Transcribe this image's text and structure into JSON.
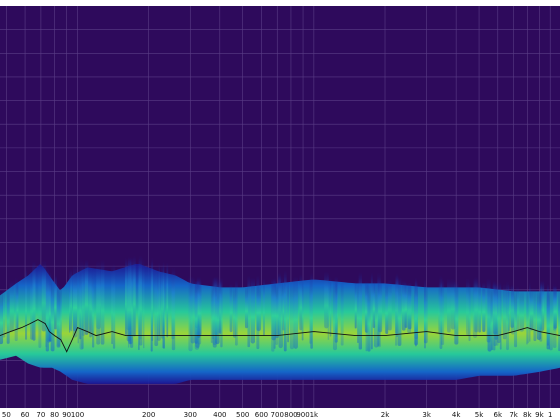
{
  "chart_data": {
    "type": "heatmap",
    "subtype": "waterfall-spectrogram",
    "title": "",
    "xlabel": "",
    "ylabel": "",
    "x_scale": "log",
    "xlim": [
      47,
      11000
    ],
    "grid": true,
    "legend": "none",
    "x_ticks": [
      {
        "value": 50,
        "label": "50"
      },
      {
        "value": 60,
        "label": "60"
      },
      {
        "value": 70,
        "label": "70"
      },
      {
        "value": 80,
        "label": "80"
      },
      {
        "value": 90,
        "label": "90"
      },
      {
        "value": 100,
        "label": "100"
      },
      {
        "value": 200,
        "label": "200"
      },
      {
        "value": 300,
        "label": "300"
      },
      {
        "value": 400,
        "label": "400"
      },
      {
        "value": 500,
        "label": "500"
      },
      {
        "value": 600,
        "label": "600"
      },
      {
        "value": 700,
        "label": "700"
      },
      {
        "value": 800,
        "label": "800"
      },
      {
        "value": 900,
        "label": "900"
      },
      {
        "value": 1000,
        "label": "1k"
      },
      {
        "value": 2000,
        "label": "2k"
      },
      {
        "value": 3000,
        "label": "3k"
      },
      {
        "value": 4000,
        "label": "4k"
      },
      {
        "value": 5000,
        "label": "5k"
      },
      {
        "value": 6000,
        "label": "6k"
      },
      {
        "value": 7000,
        "label": "7k"
      },
      {
        "value": 8000,
        "label": "8k"
      },
      {
        "value": 9000,
        "label": "9k"
      },
      {
        "value": 10000,
        "label": "1"
      }
    ],
    "colors": {
      "background": "#2e0a5c",
      "grid": "#5a3d86",
      "low": "#1a1a9a",
      "mid": "#1565c8",
      "high": "#27c99a",
      "peak": "#9ad43a",
      "trace": "#111111"
    },
    "y_range": [
      0,
      1
    ],
    "energy_profile": {
      "x": [
        47,
        55,
        62,
        70,
        78,
        85,
        95,
        110,
        140,
        180,
        220,
        260,
        300,
        400,
        500,
        700,
        1000,
        1500,
        2000,
        3000,
        4000,
        5000,
        7000,
        9000,
        11000
      ],
      "top": [
        0.28,
        0.31,
        0.33,
        0.36,
        0.32,
        0.29,
        0.33,
        0.35,
        0.34,
        0.36,
        0.34,
        0.33,
        0.31,
        0.3,
        0.3,
        0.31,
        0.32,
        0.31,
        0.31,
        0.3,
        0.3,
        0.3,
        0.29,
        0.29,
        0.29
      ],
      "bottom": [
        0.12,
        0.13,
        0.11,
        0.1,
        0.1,
        0.09,
        0.07,
        0.06,
        0.06,
        0.06,
        0.06,
        0.06,
        0.07,
        0.07,
        0.07,
        0.07,
        0.07,
        0.07,
        0.07,
        0.07,
        0.07,
        0.08,
        0.08,
        0.09,
        0.1
      ]
    },
    "average_trace": {
      "x": [
        47,
        52,
        58,
        63,
        68,
        73,
        76,
        80,
        85,
        90,
        95,
        100,
        110,
        120,
        140,
        160,
        180,
        200,
        250,
        300,
        400,
        500,
        700,
        1000,
        1500,
        2000,
        3000,
        4000,
        5000,
        6000,
        7000,
        8000,
        9000,
        11000
      ],
      "y": [
        0.18,
        0.19,
        0.2,
        0.21,
        0.22,
        0.21,
        0.19,
        0.18,
        0.17,
        0.14,
        0.17,
        0.2,
        0.19,
        0.18,
        0.19,
        0.18,
        0.18,
        0.18,
        0.18,
        0.18,
        0.18,
        0.18,
        0.18,
        0.19,
        0.18,
        0.18,
        0.19,
        0.18,
        0.18,
        0.18,
        0.19,
        0.2,
        0.19,
        0.18
      ]
    }
  }
}
